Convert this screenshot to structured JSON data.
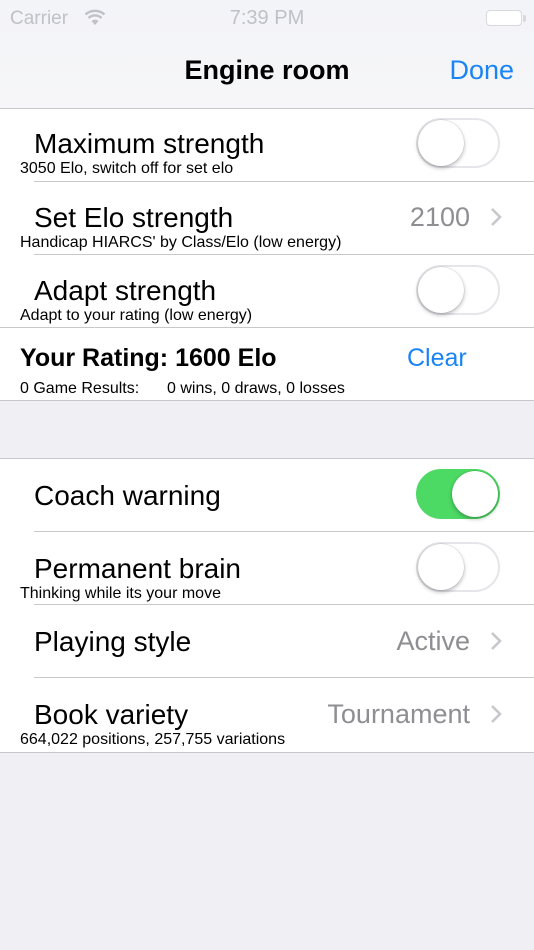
{
  "status_bar": {
    "carrier": "Carrier",
    "time": "7:39 PM"
  },
  "nav": {
    "title": "Engine room",
    "done_label": "Done"
  },
  "strength_section": {
    "maximum_strength": {
      "label": "Maximum strength",
      "subtitle": "3050 Elo, switch off for set elo",
      "on": false
    },
    "set_elo": {
      "label": "Set Elo strength",
      "subtitle": "Handicap HIARCS' by Class/Elo (low energy)",
      "value": "2100"
    },
    "adapt_strength": {
      "label": "Adapt strength",
      "subtitle": "Adapt to your rating (low energy)",
      "on": false
    },
    "rating": {
      "label": "Your Rating:  1600 Elo",
      "clear_label": "Clear",
      "results_label": "0 Game Results:",
      "results_value": "0 wins, 0 draws, 0 losses"
    }
  },
  "options_section": {
    "coach_warning": {
      "label": "Coach warning",
      "on": true
    },
    "permanent_brain": {
      "label": "Permanent brain",
      "subtitle": "Thinking while its your move",
      "on": false
    },
    "playing_style": {
      "label": "Playing style",
      "value": "Active"
    },
    "book_variety": {
      "label": "Book variety",
      "value": "Tournament",
      "subtitle": "664,022 positions, 257,755 variations"
    }
  },
  "colors": {
    "accent": "#1a84f5",
    "toggle_on": "#4cd964",
    "background": "#efeff4",
    "secondary_text": "#8e8e93"
  }
}
